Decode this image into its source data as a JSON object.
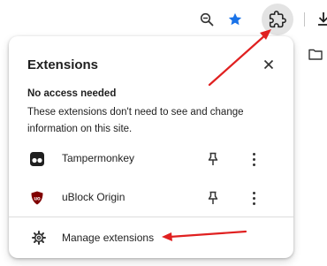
{
  "toolbar": {
    "icons": [
      "zoom-out-icon",
      "bookmark-star-icon",
      "extensions-puzzle-icon",
      "download-icon"
    ],
    "accent": "#1a73e8"
  },
  "bookmarks_bar": {
    "icons": [
      "folder-icon"
    ]
  },
  "extensions_panel": {
    "title": "Extensions",
    "close_icon": "close-icon",
    "section": {
      "heading": "No access needed",
      "description": "These extensions don't need to see and change information on this site."
    },
    "extensions": [
      {
        "name": "Tampermonkey",
        "icon": "tampermonkey-icon",
        "pin_icon": "pin-icon",
        "menu_icon": "more-vertical-icon"
      },
      {
        "name": "uBlock Origin",
        "icon": "ublock-origin-icon",
        "pin_icon": "pin-icon",
        "menu_icon": "more-vertical-icon"
      }
    ],
    "manage": {
      "label": "Manage extensions",
      "icon": "gear-icon"
    }
  },
  "annotations": {
    "arrow_color": "#e02020"
  }
}
